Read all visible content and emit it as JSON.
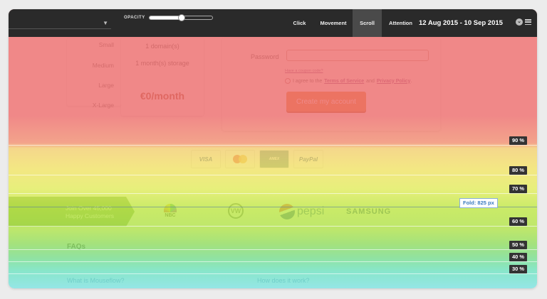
{
  "toolbar": {
    "opacity_label": "OPACITY",
    "opacity_level": 0.5,
    "tabs": [
      {
        "label": "Click",
        "active": false
      },
      {
        "label": "Movement",
        "active": false
      },
      {
        "label": "Scroll",
        "active": true
      },
      {
        "label": "Attention",
        "active": false
      }
    ],
    "date_range": "12 Aug 2015 - 10 Sep 2015"
  },
  "page": {
    "sizes": [
      "Small",
      "Medium",
      "Large",
      "X-Large"
    ],
    "plan": {
      "domains": "1 domain(s)",
      "storage": "1 month(s) storage",
      "price": "€0/month"
    },
    "form": {
      "password_label": "Password",
      "coupon_link": "Have a coupon code?",
      "agree_prefix": "I agree to the",
      "terms_link": "Terms of Service",
      "agree_and": "and",
      "privacy_link": "Privacy Policy",
      "agree_suffix": ".",
      "create_button": "Create my account"
    },
    "payment": {
      "visa": "VISA",
      "amex": "AMEX",
      "paypal": "PayPal"
    },
    "join": {
      "line1": "Join Over 45,000",
      "line2": "Happy Customers"
    },
    "logos": {
      "nbc": "NBC",
      "vw": "VW",
      "pepsi": "pepsi",
      "samsung": "SAMSUNG"
    },
    "faqs": "FAQs",
    "question1": "What is Mouseflow?",
    "question2": "How does it work?"
  },
  "heatmap": {
    "markers": [
      {
        "label": "90 %"
      },
      {
        "label": "80 %"
      },
      {
        "label": "70 %"
      },
      {
        "label": "60 %"
      },
      {
        "label": "50 %"
      },
      {
        "label": "40 %"
      },
      {
        "label": "30 %"
      }
    ],
    "fold_label": "Fold: 825 px"
  },
  "colors": {
    "toolbar_bg": "#2a2a2a",
    "button_orange": "#e58a2c",
    "link_purple": "#8a4a8a",
    "heat_hot": "#ed6e6e",
    "heat_cold": "#82e1e1"
  }
}
